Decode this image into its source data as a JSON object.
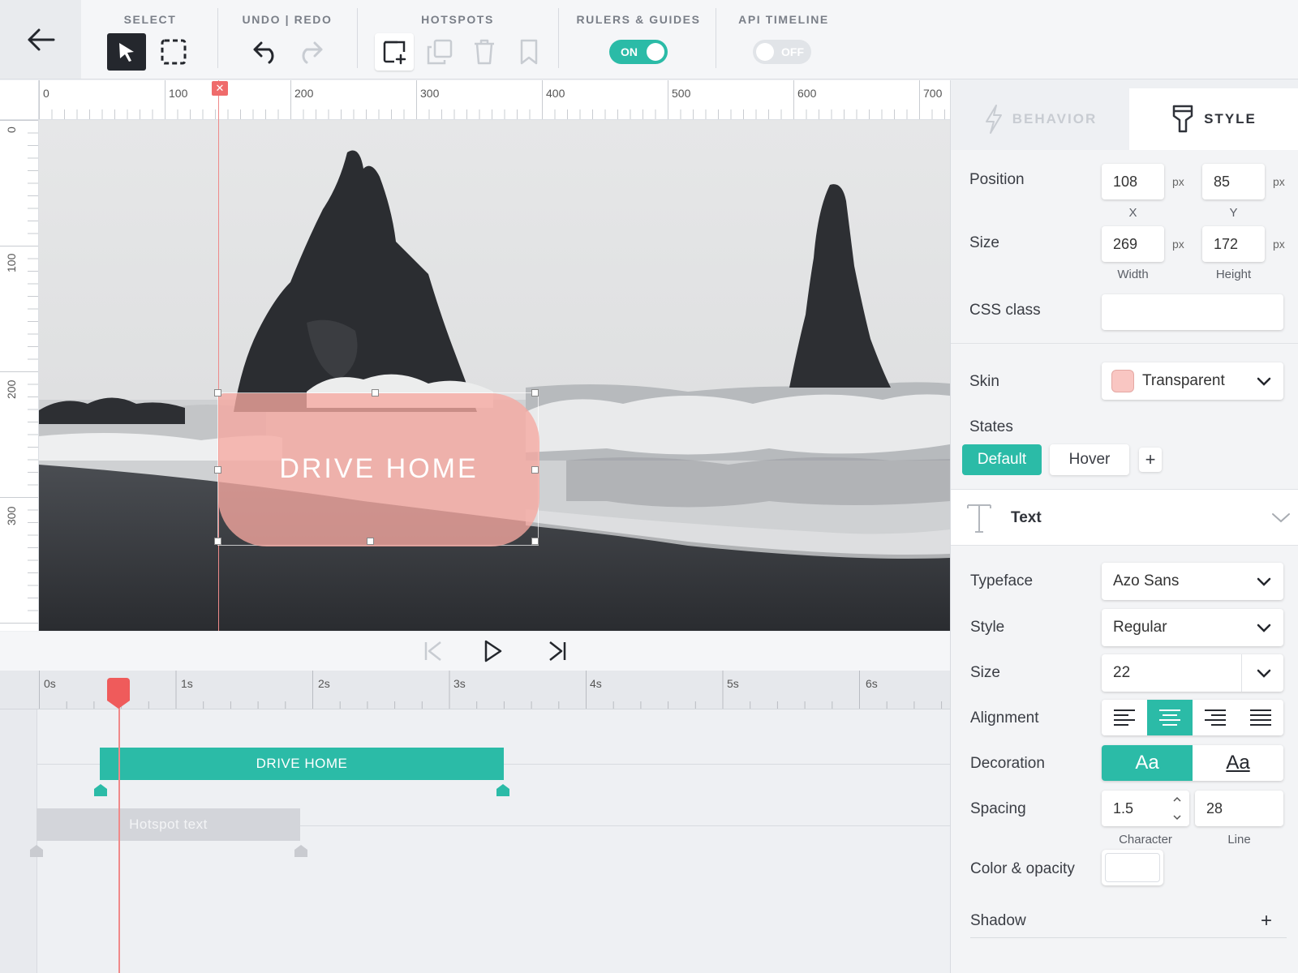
{
  "toolbar": {
    "back_icon": "arrow-left-icon",
    "groups": {
      "select": "SELECT",
      "undo_redo": "UNDO | REDO",
      "hotspots": "HOTSPOTS",
      "rulers": "RULERS & GUIDES",
      "api_timeline": "API TIMELINE"
    },
    "rulers_toggle": "ON",
    "api_toggle": "OFF"
  },
  "rulers": {
    "horizontal": [
      "0",
      "100",
      "200",
      "300",
      "400",
      "500",
      "600",
      "700"
    ],
    "vertical": [
      "0",
      "100",
      "200",
      "300"
    ]
  },
  "canvas": {
    "hotspot_text": "DRIVE HOME",
    "guide_close": "✕"
  },
  "timeline": {
    "ticks": [
      "0s",
      "1s",
      "2s",
      "3s",
      "4s",
      "5s",
      "6s"
    ],
    "clips": [
      {
        "label": "DRIVE HOME"
      },
      {
        "label": "Hotspot text"
      }
    ]
  },
  "panel": {
    "tabs": {
      "behavior": "BEHAVIOR",
      "style": "STYLE"
    },
    "position": {
      "label": "Position",
      "x": "108",
      "y": "85",
      "x_caption": "X",
      "y_caption": "Y",
      "unit": "px"
    },
    "size": {
      "label": "Size",
      "width": "269",
      "height": "172",
      "width_caption": "Width",
      "height_caption": "Height",
      "unit": "px"
    },
    "css_class": {
      "label": "CSS class",
      "value": ""
    },
    "skin": {
      "label": "Skin",
      "value": "Transparent",
      "swatch": "#f9c6c2"
    },
    "states": {
      "label": "States",
      "default": "Default",
      "hover": "Hover",
      "add": "+"
    },
    "text_section": {
      "label": "Text"
    },
    "typeface": {
      "label": "Typeface",
      "value": "Azo Sans"
    },
    "style": {
      "label": "Style",
      "value": "Regular"
    },
    "font_size": {
      "label": "Size",
      "value": "22"
    },
    "alignment": {
      "label": "Alignment",
      "selected": "center"
    },
    "decoration": {
      "label": "Decoration",
      "normal": "Aa",
      "underline": "Aa"
    },
    "spacing": {
      "label": "Spacing",
      "character": "1.5",
      "line": "28",
      "character_caption": "Character",
      "line_caption": "Line"
    },
    "color": {
      "label": "Color & opacity",
      "value": "#ffffff"
    },
    "shadow": {
      "label": "Shadow",
      "add": "+"
    }
  },
  "colors": {
    "accent": "#2bbba7",
    "playhead": "#ef5b5b",
    "hotspot_fill": "#f6a8a0"
  }
}
